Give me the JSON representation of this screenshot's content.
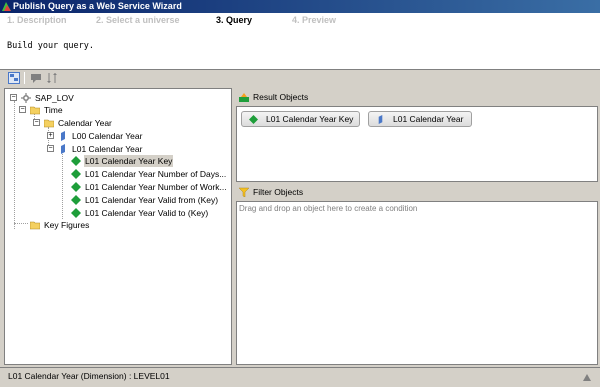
{
  "window": {
    "title": "Publish Query as a Web Service Wizard"
  },
  "steps": [
    {
      "label": "1. Description",
      "active": false
    },
    {
      "label": "2. Select a universe",
      "active": false
    },
    {
      "label": "3. Query",
      "active": true
    },
    {
      "label": "4. Preview",
      "active": false
    }
  ],
  "instruction": "Build your query.",
  "tree": {
    "root": "SAP_LOV",
    "time": "Time",
    "calendar_year": "Calendar Year",
    "l00_calendar_year": "L00 Calendar Year",
    "l01_calendar_year": "L01 Calendar Year",
    "items": [
      "L01 Calendar Year Key",
      "L01 Calendar Year Number of Days...",
      "L01 Calendar Year Number of Work...",
      "L01 Calendar Year Valid from (Key)",
      "L01 Calendar Year Valid to (Key)"
    ],
    "key_figures": "Key Figures",
    "expander_plus": "+",
    "expander_minus": "−"
  },
  "result_objects": {
    "label": "Result Objects",
    "items": [
      "L01 Calendar Year Key",
      "L01 Calendar Year"
    ]
  },
  "filter_objects": {
    "label": "Filter Objects",
    "hint": "Drag and drop an object here to create a condition"
  },
  "status": "L01 Calendar Year (Dimension) : LEVEL01",
  "colors": {
    "title_bar": "#0a246a",
    "folder": "#f4d060",
    "dimension_green": "#1e9e3a",
    "level_blue": "#4a78c8"
  }
}
